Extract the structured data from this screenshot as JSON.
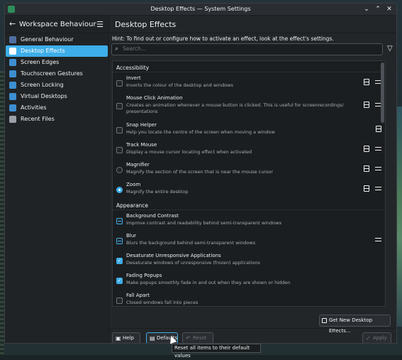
{
  "window": {
    "title": "Desktop Effects — System Settings"
  },
  "sidebar": {
    "title": "Workspace Behaviour",
    "items": [
      {
        "label": "General Behaviour",
        "color": "#4f6fa0"
      },
      {
        "label": "Desktop Effects",
        "color": "#ffffff"
      },
      {
        "label": "Screen Edges",
        "color": "#3d8fd1"
      },
      {
        "label": "Touchscreen Gestures",
        "color": "#3d8fd1"
      },
      {
        "label": "Screen Locking",
        "color": "#3d8fd1"
      },
      {
        "label": "Virtual Desktops",
        "color": "#3d8fd1"
      },
      {
        "label": "Activities",
        "color": "#3d8fd1"
      },
      {
        "label": "Recent Files",
        "color": "#9aa0a6"
      }
    ],
    "active_index": 1
  },
  "main": {
    "title": "Desktop Effects",
    "hint": "Hint: To find out or configure how to activate an effect, look at the effect's settings.",
    "search_placeholder": "Search...",
    "sections": [
      {
        "label": "Accessibility",
        "effects": [
          {
            "name": "Invert",
            "desc": "Inverts the colour of the desktop and windows",
            "control": "checkbox",
            "checked": false
          },
          {
            "name": "Mouse Click Animation",
            "desc": "Creates an animation whenever a mouse button is clicked. This is useful for screenrecordings/ presentations",
            "control": "checkbox",
            "checked": false
          },
          {
            "name": "Snap Helper",
            "desc": "Help you locate the centre of the screen when moving a window",
            "control": "checkbox",
            "checked": false
          },
          {
            "name": "Track Mouse",
            "desc": "Display a mouse cursor locating effect when activated",
            "control": "checkbox",
            "checked": false
          },
          {
            "name": "Magnifier",
            "desc": "Magnify the section of the screen that is near the mouse cursor",
            "control": "radio",
            "checked": false
          },
          {
            "name": "Zoom",
            "desc": "Magnify the entire desktop",
            "control": "radio",
            "checked": true
          }
        ]
      },
      {
        "label": "Appearance",
        "effects": [
          {
            "name": "Background Contrast",
            "desc": "Improve contrast and readability behind semi-transparent windows",
            "control": "checkbox",
            "state": "partial"
          },
          {
            "name": "Blur",
            "desc": "Blurs the background behind semi-transparent windows",
            "control": "checkbox",
            "state": "partial"
          },
          {
            "name": "Desaturate Unresponsive Applications",
            "desc": "Desaturate windows of unresponsive (frozen) applications",
            "control": "checkbox",
            "checked": true
          },
          {
            "name": "Fading Popups",
            "desc": "Make popups smoothly fade in and out when they are shown or hidden",
            "control": "checkbox",
            "checked": true
          },
          {
            "name": "Fall Apart",
            "desc": "Closed windows fall into pieces",
            "control": "checkbox",
            "checked": false
          }
        ]
      }
    ],
    "get_new_label": "Get New Desktop Effects..."
  },
  "footer": {
    "help_label": "Help",
    "defaults_label": "Defaults",
    "reset_label": "Reset",
    "apply_label": "Apply"
  },
  "tooltip": "Reset all items to their default values"
}
